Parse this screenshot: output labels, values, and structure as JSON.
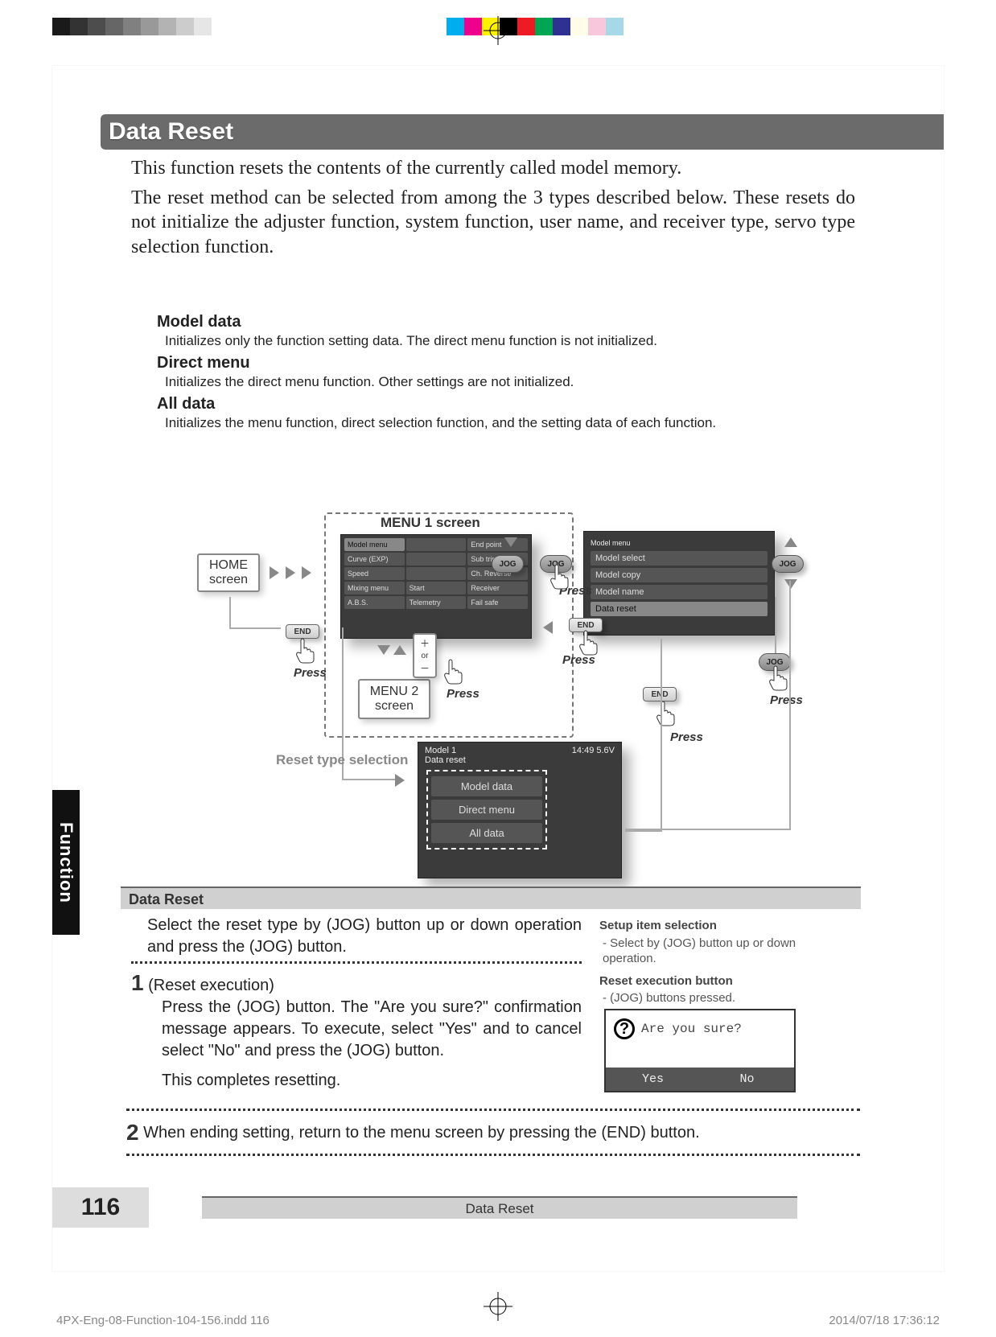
{
  "swatches_gray": [
    "#1a1a1a",
    "#333333",
    "#4d4d4d",
    "#666666",
    "#808080",
    "#999999",
    "#b3b3b3",
    "#cccccc",
    "#e6e6e6",
    "#ffffff"
  ],
  "swatches_cmyk": [
    "#00aeef",
    "#ec008c",
    "#fff200",
    "#000000",
    "#ed1c24",
    "#00a651",
    "#2e3192",
    "#fffde7",
    "#f7c7dc",
    "#a6d8e7",
    "#ffffff"
  ],
  "title": "Data Reset",
  "intro": {
    "p1": "This function resets the contents of the currently called model memory.",
    "p2": "The reset method can be selected from among the 3 types described below. These resets do not initialize the adjuster function, system function, user name, and receiver type, servo type selection function."
  },
  "defs": {
    "model_data_term": "Model data",
    "model_data_desc": "Initializes only the function setting data. The direct menu function is not initialized.",
    "direct_menu_term": "Direct menu",
    "direct_menu_desc": "Initializes the direct menu function. Other settings are not initialized.",
    "all_data_term": "All data",
    "all_data_desc": "Initializes the menu function, direct selection function, and the setting data of each function."
  },
  "diagram": {
    "menu1_label": "MENU 1 screen",
    "home": "HOME screen",
    "menu2": "MENU 2 screen",
    "pm_or": "or",
    "jog": "JOG",
    "end": "END",
    "press": "Press",
    "reset_type_label": "Reset type selection",
    "menu1_items": {
      "r0c0": "Model menu",
      "r0c1": "",
      "r0c2": "End point",
      "r1c0": "Curve (EXP)",
      "r1c1": "",
      "r1c2": "Sub trim",
      "r2c0": "Speed",
      "r2c1": "",
      "r2c2": "Ch. Reverse",
      "r3c0": "Mixing menu",
      "r3c1": "Start",
      "r3c2": "Receiver",
      "r4c0": "A.B.S.",
      "r4c1": "Telemetry",
      "r4c2": "Fail safe"
    },
    "modelmenu_hdr": "Model menu",
    "modelmenu_items": [
      "Model select",
      "Model copy",
      "Model name",
      "Data reset"
    ],
    "reset_screen": {
      "hdr_left": "Model 1",
      "hdr_right": "14:49 5.6V",
      "sub": "Data reset",
      "opts": [
        "Model data",
        "Direct menu",
        "All data"
      ]
    }
  },
  "sub_bar": "Data Reset",
  "instructions": {
    "lead": "Select the reset type by (JOG) button up or down operation and press the (JOG) button.",
    "step1_num": "1",
    "step1_title": "(Reset execution)",
    "step1_body": "Press the (JOG) button. The \"Are you sure?\" confirmation message appears. To execute, select \"Yes\" and to cancel select \"No\" and press the (JOG) button.",
    "step1_done": "This completes resetting.",
    "step2_num": "2",
    "step2_body": "When ending setting, return to the menu screen by pressing the (END) button."
  },
  "sidebar": {
    "h1": "Setup item selection",
    "h1_item": "Select by (JOG) button up or down operation.",
    "h2": "Reset execution button",
    "h2_item": "(JOG) buttons pressed.",
    "confirm_msg": "Are you sure?",
    "yes": "Yes",
    "no": "No"
  },
  "footer": {
    "band": "Data Reset",
    "page": "116",
    "tab": "Function"
  },
  "imprint": {
    "left": "4PX-Eng-08-Function-104-156.indd   116",
    "right": "2014/07/18   17:36:12"
  }
}
